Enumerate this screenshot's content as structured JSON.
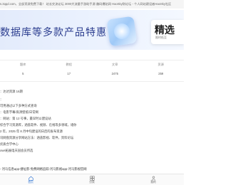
{
  "top_ticker": {
    "text": "s.3qqd.com，全部资源免费下载！ 站长交流论坛 3000大流量手游助手源 趣码爆贴网 HaoSky财论坛 - 个人网站建设者HaoSky社区"
  },
  "banner": {
    "title": "数据库等多款产品特惠",
    "card_title": "精选",
    "card_sub": "限时低至"
  },
  "stats": [
    {
      "label": "题库",
      "value": "5"
    },
    {
      "label": "教程",
      "value": "17"
    },
    {
      "label": "文章",
      "value": "2475"
    },
    {
      "label": "资源",
      "value": "259"
    }
  ],
  "notice": {
    "title": "：达达资源 16期",
    "lines": [
      "：",
      "可用通过以下多种方式查询",
      "：电影字幕/高清壁纸/日常网",
      "：网站：第 12 号事，最早时以建设站",
      "综合学习资源库，涵盖软件、视频、在线等多领域，诸你",
      "2 年，2025 年 8 月中旬建设的日后的发布资源",
      "讯网盘资源分享网站方法：涵盖影视、软件，资料论坛",
      "优质合学中心",
      "ows拓展电天园会员所选"
    ]
  },
  "footer_links": {
    "text": "- 河马信息app-捷址影-免费网络追踪-河马影视app-河马影视官网"
  },
  "bottom_nav": [
    {
      "label": "首页",
      "icon": "home-icon"
    },
    {
      "label": "分类",
      "icon": "category-icon"
    },
    {
      "label": "我的",
      "icon": "user-icon"
    }
  ],
  "colors": {
    "accent": "#3a7bd5",
    "banner_text": "#2b3d8f"
  }
}
